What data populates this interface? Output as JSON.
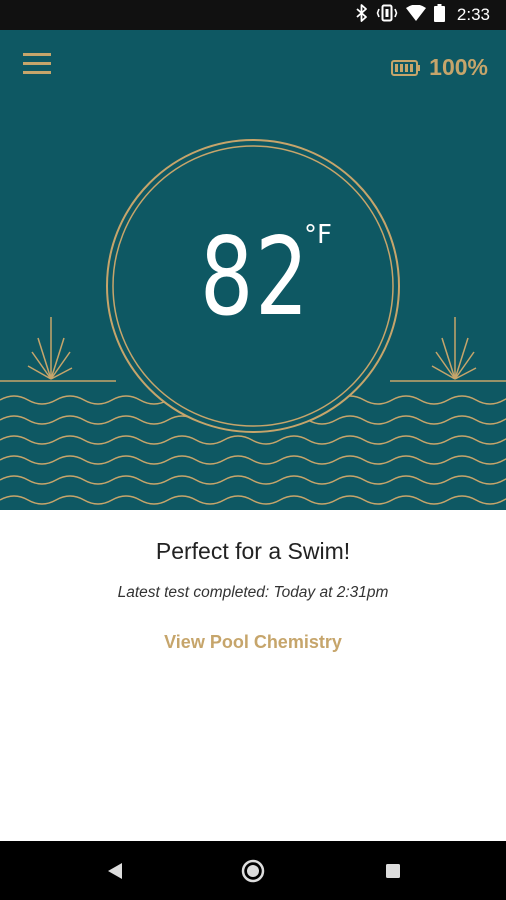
{
  "status_bar": {
    "time": "2:33",
    "icons": [
      "bluetooth-icon",
      "vibrate-icon",
      "wifi-icon",
      "battery-icon"
    ]
  },
  "header": {
    "menu_icon": "hamburger-menu-icon",
    "battery_icon": "battery-icon",
    "battery_level": "100%"
  },
  "reading": {
    "temperature": "82",
    "unit": "°F"
  },
  "status": {
    "headline": "Perfect for a Swim!",
    "latest_test": "Latest test completed: Today at 2:31pm",
    "chemistry_link": "View Pool Chemistry"
  },
  "nav": {
    "buttons": [
      "back-icon",
      "home-icon",
      "recents-icon"
    ]
  },
  "colors": {
    "hero_background": "#0e5863",
    "accent_gold": "#c6a56b",
    "text_dark": "#222222",
    "status_bar": "#111111",
    "nav_bar": "#000000"
  }
}
